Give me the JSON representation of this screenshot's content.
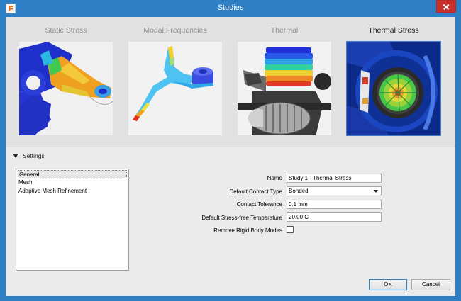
{
  "window": {
    "title": "Studies",
    "app_icon": "fusion-f-icon",
    "accent": "#2e7fc4"
  },
  "studies": [
    {
      "label": "Static Stress",
      "selected": false,
      "thumb": "static-stress-bracket-thumbnail"
    },
    {
      "label": "Modal Frequencies",
      "selected": false,
      "thumb": "modal-frequencies-beam-thumbnail"
    },
    {
      "label": "Thermal",
      "selected": false,
      "thumb": "thermal-engine-thumbnail"
    },
    {
      "label": "Thermal Stress",
      "selected": true,
      "thumb": "thermal-stress-turbine-thumbnail"
    }
  ],
  "settings": {
    "toggle_label": "Settings",
    "sections": [
      "General",
      "Mesh",
      "Adaptive Mesh Refinement"
    ],
    "active_section": "General"
  },
  "general": {
    "name_label": "Name",
    "name_value": "Study 1 - Thermal Stress",
    "contact_type_label": "Default Contact Type",
    "contact_type_value": "Bonded",
    "contact_tolerance_label": "Contact Tolerance",
    "contact_tolerance_value": "0.1 mm",
    "stress_free_temp_label": "Default Stress-free Temperature",
    "stress_free_temp_value": "20.00 C",
    "remove_rigid_label": "Remove Rigid Body Modes",
    "remove_rigid_checked": false
  },
  "buttons": {
    "ok": "OK",
    "cancel": "Cancel"
  }
}
